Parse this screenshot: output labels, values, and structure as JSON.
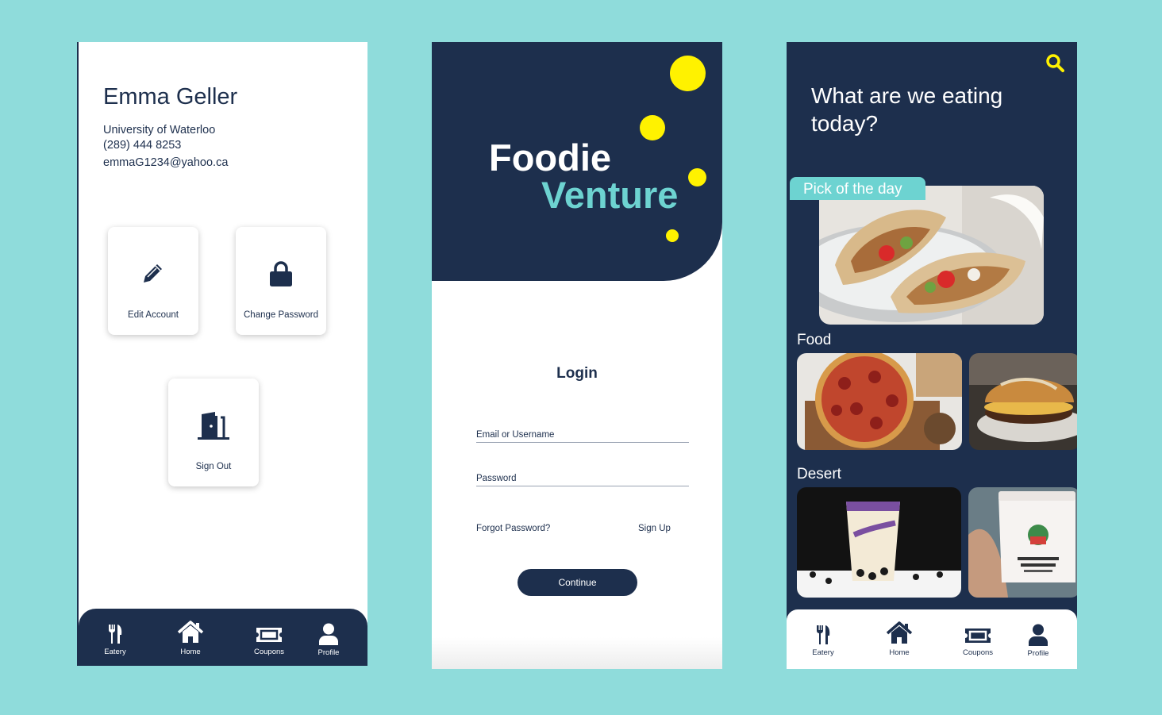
{
  "profile": {
    "name": "Emma Geller",
    "school": "University of Waterloo",
    "phone": "(289) 444 8253",
    "email": "emmaG1234@yahoo.ca",
    "edit_label": "Edit Account",
    "password_label": "Change Password",
    "signout_label": "Sign Out"
  },
  "login": {
    "brand_line1": "Foodie",
    "brand_line2": "Venture",
    "title": "Login",
    "email_label": "Email or Username",
    "password_label": "Password",
    "forgot_label": "Forgot Password?",
    "signup_label": "Sign Up",
    "continue_label": "Continue"
  },
  "home": {
    "question": "What are we eating today?",
    "pick_label": "Pick of the day",
    "food_label": "Food",
    "desert_label": "Desert"
  },
  "tabs": {
    "eatery": "Eatery",
    "home": "Home",
    "coupons": "Coupons",
    "profile": "Profile"
  },
  "colors": {
    "navy": "#1d2f4d",
    "teal": "#6dd3d1",
    "yellow": "#fff200",
    "background": "#8fdcdb"
  }
}
